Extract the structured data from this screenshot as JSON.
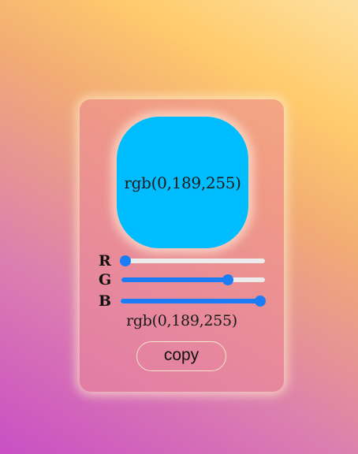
{
  "color": {
    "r": 0,
    "g": 189,
    "b": 255
  },
  "swatch_label": "rgb(0,189,255)",
  "value_text": "rgb(0,189,255)",
  "sliders": [
    {
      "label": "R",
      "value": 0,
      "max": 255
    },
    {
      "label": "G",
      "value": 189,
      "max": 255
    },
    {
      "label": "B",
      "value": 255,
      "max": 255
    }
  ],
  "copy_label": "copy",
  "slider_color": "#1a7df5",
  "track_color": "#ececec"
}
